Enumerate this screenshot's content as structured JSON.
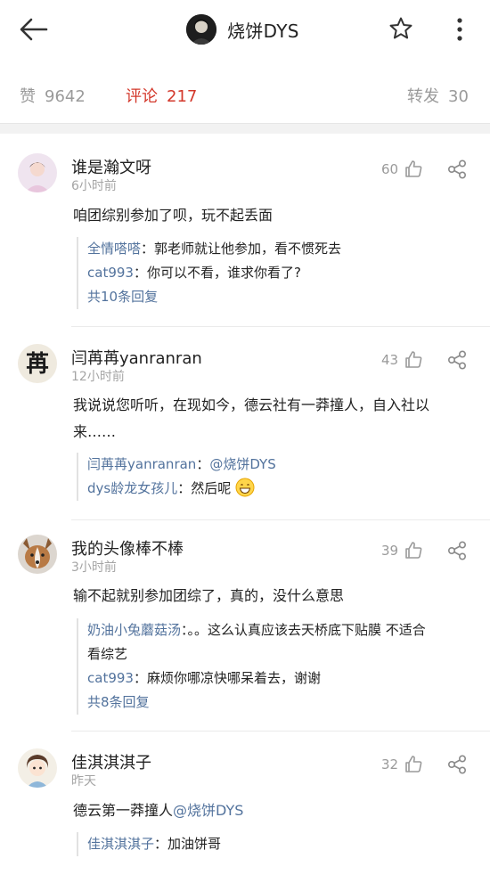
{
  "header": {
    "title": "烧饼DYS"
  },
  "stats": {
    "like_label": "赞",
    "like_count": "9642",
    "comment_label": "评论",
    "comment_count": "217",
    "repost_label": "转发",
    "repost_count": "30"
  },
  "comments": [
    {
      "name": "谁是瀚文呀",
      "time": "6小时前",
      "likes": "60",
      "text": "咱团综别参加了呗，玩不起丢面",
      "replies": [
        {
          "name": "全情嗒嗒",
          "text": "：郭老师就让他参加，看不惯死去"
        },
        {
          "name": "cat993",
          "text": "：你可以不看，谁求你看了?"
        }
      ],
      "more_replies": "共10条回复"
    },
    {
      "name": "闫苒苒yanranran",
      "time": "12小时前",
      "likes": "43",
      "text_line1": "我说说您听听，在现如今，德云社有一莽撞人，自入社以",
      "text_line2": "来……",
      "replies": [
        {
          "name": "闫苒苒yanranran",
          "text": "：",
          "mention": "@烧饼DYS"
        },
        {
          "name": "dys龄龙女孩儿",
          "text": "：然后呢"
        }
      ],
      "avatar_char": "苒"
    },
    {
      "name": "我的头像棒不棒",
      "time": "3小时前",
      "likes": "39",
      "text": "输不起就别参加团综了，真的，没什么意思",
      "replies": [
        {
          "name": "奶油小兔蘑菇汤",
          "text": "：。。这么认真应该去天桥底下贴膜 不适合",
          "text2": "看综艺"
        },
        {
          "name": "cat993",
          "text": "：麻烦你哪凉快哪呆着去，谢谢"
        }
      ],
      "more_replies": "共8条回复"
    },
    {
      "name": "佳淇淇淇子",
      "time": "昨天",
      "likes": "32",
      "text": "德云第一莽撞人",
      "text_mention": "@烧饼DYS",
      "replies": [
        {
          "name": "佳淇淇淇子",
          "text": "：加油饼哥"
        }
      ]
    }
  ],
  "colors": {
    "accent": "#d3382b",
    "link": "#53739d",
    "muted": "#9a9a9a"
  }
}
